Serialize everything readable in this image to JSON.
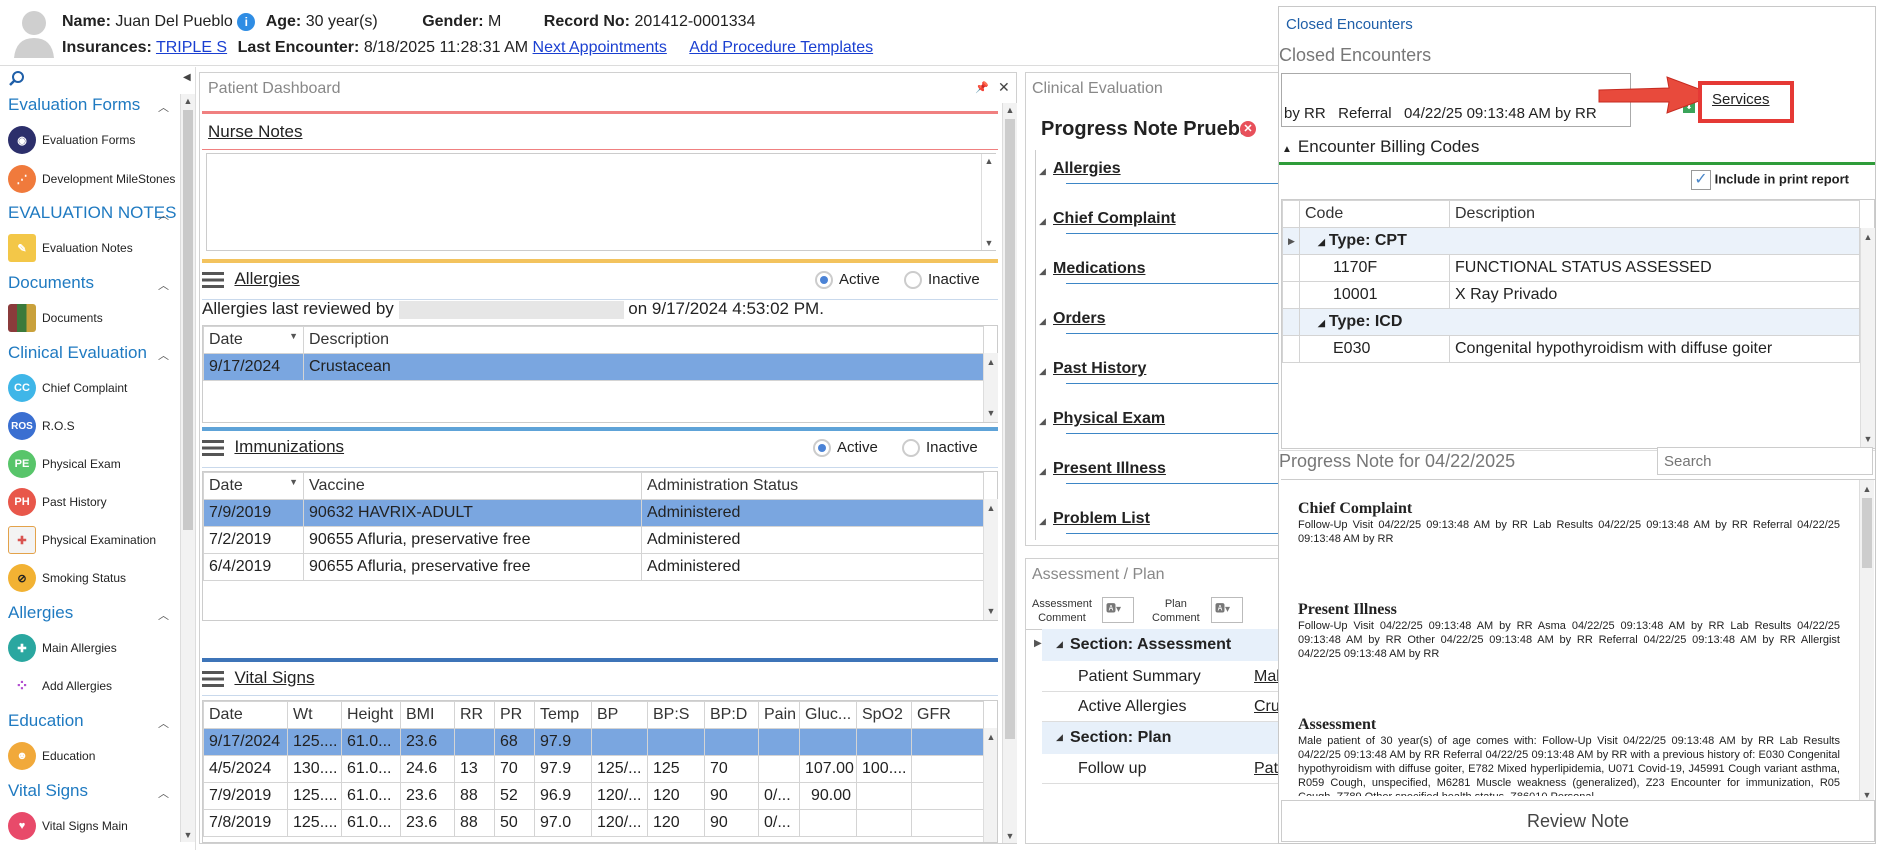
{
  "header": {
    "name_label": "Name:",
    "name": "Juan Del Pueblo",
    "age_label": "Age:",
    "age": "30 year(s)",
    "gender_label": "Gender:",
    "gender": "M",
    "record_label": "Record No:",
    "record": "201412-0001334",
    "insurance_label": "Insurances:",
    "insurance": "TRIPLE S",
    "last_enc_label": "Last Encounter:",
    "last_enc": "8/18/2025 11:28:31 AM",
    "next_appt": "Next Appointments",
    "add_proc": "Add Procedure Templates"
  },
  "sidebar": {
    "groups": [
      {
        "title": "Evaluation Forms",
        "items": [
          "Evaluation Forms",
          "Development MileStones"
        ]
      },
      {
        "title": "EVALUATION NOTES",
        "items": [
          "Evaluation Notes"
        ]
      },
      {
        "title": "Documents",
        "items": [
          "Documents"
        ]
      },
      {
        "title": "Clinical Evaluation",
        "items": [
          "Chief Complaint",
          "R.O.S",
          "Physical Exam",
          "Past History",
          "Physical Examination",
          "Smoking Status"
        ]
      },
      {
        "title": "Allergies",
        "items": [
          "Main Allergies",
          "Add Allergies"
        ]
      },
      {
        "title": "Education",
        "items": [
          "Education"
        ]
      },
      {
        "title": "Vital Signs",
        "items": [
          "Vital Signs Main"
        ]
      }
    ],
    "icon_text": {
      "cc": "CC",
      "ros": "ROS",
      "pe": "PE",
      "ph": "PH"
    }
  },
  "dashboard": {
    "title": "Patient Dashboard",
    "nurse_notes": "Nurse Notes",
    "allergies": {
      "title": "Allergies",
      "active": "Active",
      "inactive": "Inactive",
      "reviewed_prefix": "Allergies last reviewed by",
      "reviewed_suffix": "on 9/17/2024 4:53:02 PM.",
      "columns": [
        "Date",
        "Description"
      ],
      "rows": [
        [
          "9/17/2024",
          "Crustacean"
        ]
      ]
    },
    "immunizations": {
      "title": "Immunizations",
      "active": "Active",
      "inactive": "Inactive",
      "columns": [
        "Date",
        "Vaccine",
        "Administration Status"
      ],
      "rows": [
        [
          "7/9/2019",
          "90632 HAVRIX-ADULT",
          "Administered"
        ],
        [
          "7/2/2019",
          "90655 Afluria, preservative free",
          "Administered"
        ],
        [
          "6/4/2019",
          "90655 Afluria, preservative free",
          "Administered"
        ]
      ]
    },
    "vitals": {
      "title": "Vital Signs",
      "columns": [
        "Date",
        "Wt",
        "Height",
        "BMI",
        "RR",
        "PR",
        "Temp",
        "BP",
        "BP:S",
        "BP:D",
        "Pain",
        "Gluc...",
        "SpO2",
        "GFR"
      ],
      "rows": [
        [
          "9/17/2024",
          "125....",
          "61.0...",
          "23.6",
          "",
          "68",
          "97.9",
          "",
          "",
          "",
          "",
          "",
          "",
          ""
        ],
        [
          "4/5/2024",
          "130....",
          "61.0...",
          "24.6",
          "13",
          "70",
          "97.9",
          "125/...",
          "125",
          "70",
          "",
          "107.00",
          "100....",
          ""
        ],
        [
          "7/9/2019",
          "125....",
          "61.0...",
          "23.6",
          "88",
          "52",
          "96.9",
          "120/...",
          "120",
          "90",
          "0/...",
          "90.00",
          "",
          ""
        ],
        [
          "7/8/2019",
          "125....",
          "61.0...",
          "23.6",
          "88",
          "50",
          "97.0",
          "120/...",
          "120",
          "90",
          "0/...",
          "",
          "",
          ""
        ]
      ]
    }
  },
  "clinical": {
    "title": "Clinical Evaluation",
    "note_title": "Progress Note Prueba",
    "sections": [
      "Allergies",
      "Chief Complaint",
      "Medications",
      "Orders",
      "Past History",
      "Physical Exam",
      "Present Illness",
      "Problem List"
    ]
  },
  "assessment": {
    "title": "Assessment / Plan",
    "assessment_comment_1": "Assessment",
    "assessment_comment_2": "Comment",
    "plan_comment_1": "Plan",
    "plan_comment_2": "Comment",
    "section_assessment": "Section: Assessment",
    "patient_summary": "Patient Summary",
    "patient_summary_val": "Mal",
    "active_allergies": "Active Allergies",
    "active_allergies_val": "Cru",
    "section_plan": "Section: Plan",
    "follow_up": "Follow up",
    "follow_up_val": "Pati"
  },
  "right": {
    "closed_link": "Closed Encounters",
    "closed_title": "Closed Encounters",
    "encounter_text": "by RR   Referral   04/22/25 09:13:48 AM by RR",
    "services": "Services",
    "billing_title": "Encounter Billing Codes",
    "include_print": "Include in print report",
    "columns": [
      "Code",
      "Description"
    ],
    "type_cpt": "Type: CPT",
    "cpt_rows": [
      [
        "1170F",
        "FUNCTIONAL STATUS ASSESSED"
      ],
      [
        "10001",
        "X Ray Privado"
      ]
    ],
    "type_icd": "Type: ICD",
    "icd_rows": [
      [
        "E030",
        "Congenital hypothyroidism with diffuse goiter"
      ]
    ],
    "progress_title": "Progress Note for 04/22/2025",
    "search_placeholder": "Search",
    "note": {
      "cc_h": "Chief Complaint",
      "cc_t": "Follow-Up Visit 04/22/25 09:13:48 AM by RR Lab Results 04/22/25 09:13:48 AM by RR Referral 04/22/25 09:13:48 AM by RR",
      "pi_h": "Present Illness",
      "pi_t": "Follow-Up Visit 04/22/25 09:13:48 AM by RR Asma 04/22/25 09:13:48 AM by RR Lab Results 04/22/25 09:13:48 AM by RR Other 04/22/25 09:13:48 AM by RR Referral 04/22/25 09:13:48 AM by RR Allergist 04/22/25 09:13:48 AM by RR",
      "as_h": "Assessment",
      "as_t": "Male patient of 30 year(s) of age comes with: Follow-Up Visit 04/22/25 09:13:48 AM by RR Lab Results 04/22/25 09:13:48 AM by RR Referral 04/22/25 09:13:48 AM by RR with a previous history of: E030 Congenital hypothyroidism with diffuse goiter, E782 Mixed hyperlipidemia, U071 Covid-19, J45991 Cough variant asthma, R059 Cough, unspecified, M6281 Muscle weakness (generalized), Z23 Encounter for immunization, R05 Cough, Z789 Other specified health status, Z86010 Personal"
    },
    "review_note": "Review Note"
  },
  "colors": {
    "accent_blue": "#1f7ac1",
    "selected_row": "#7aa6e0",
    "callout_red": "#e53935"
  }
}
